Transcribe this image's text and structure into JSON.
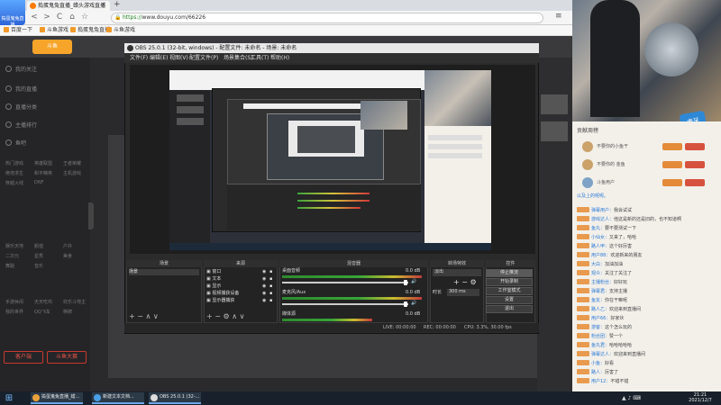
{
  "browser": {
    "tab_title": "捣蛋鬼兔直播_蜡头游戏直播",
    "tab_close": "×",
    "new_tab": "+",
    "url_scheme": "https://",
    "url_host": "www.douyu.com/",
    "url_path": "66226",
    "nav": {
      "back": "<",
      "forward": ">",
      "reload": "C",
      "home": "⌂",
      "favorite": "☆"
    },
    "bookmarks": [
      "百度一下",
      "斗鱼游戏",
      "捣蛋鬼兔直播",
      "斗鱼游戏"
    ]
  },
  "logo_text": "捣蛋鬼兔直播",
  "site": {
    "logo": "斗鱼",
    "sidebar_items": [
      "我的关注",
      "我的直播",
      "直播分类",
      "主播排行",
      "鱼吧"
    ],
    "sidebar_grid_1": [
      "热门游戏",
      "英雄联盟",
      "王者荣耀",
      "绝地求生",
      "和平精英",
      "主机游戏",
      "穿越火线",
      "DNF"
    ],
    "sidebar_grid_2": [
      "娱乐天地",
      "颜值",
      "户外",
      "二次元",
      "星秀",
      "美食",
      "舞蹈",
      "音乐"
    ],
    "sidebar_grid_3": [
      "手游休闲",
      "天天吃鸡",
      "欢乐斗地主",
      "我的世界",
      "QQ飞车",
      "棋牌"
    ],
    "side_btn_1": "客户端",
    "side_btn_2": "斗鱼大赛"
  },
  "cam": {
    "badge": "虎牙"
  },
  "chat": {
    "rank_title": "贡献周榜",
    "ranks": [
      "不要你的小鱼干",
      "不要你的 金鱼",
      "斗鱼用户"
    ],
    "welcome": "以及上的呢呢。",
    "messages": [
      {
        "user": "弹幕用户",
        "text": "我会试试"
      },
      {
        "user": "游戏达人",
        "text": "他这是新的还是旧的，也不知道啊"
      },
      {
        "user": "鱼丸",
        "text": "要不要测试一下"
      },
      {
        "user": "小仙女",
        "text": "又来了，哈哈"
      },
      {
        "user": "路人甲",
        "text": "这个好厉害"
      },
      {
        "user": "用户88",
        "text": "欢迎新来的朋友"
      },
      {
        "user": "大白",
        "text": "加油加油"
      },
      {
        "user": "观众",
        "text": "关注了关注了"
      },
      {
        "user": "主播粉丝",
        "text": "好好玩"
      },
      {
        "user": "弹幕君",
        "text": "支持主播"
      },
      {
        "user": "鱼友",
        "text": "你在干嘛呢"
      },
      {
        "user": "路人乙",
        "text": "欢迎来到直播间"
      },
      {
        "user": "用户66",
        "text": "好家伙"
      },
      {
        "user": "游客",
        "text": "这个怎么玩的"
      },
      {
        "user": "粉丝团",
        "text": "赞一个"
      },
      {
        "user": "鱼丸君",
        "text": "哈哈哈哈哈"
      },
      {
        "user": "弹幕达人",
        "text": "欢迎来到直播间"
      },
      {
        "user": "小鱼",
        "text": "好看"
      },
      {
        "user": "路人",
        "text": "厉害了"
      },
      {
        "user": "用户12",
        "text": "不错不错"
      }
    ]
  },
  "obs": {
    "title": "OBS 25.0.1 (32-bit, windows) - 配置文件: 未命名 - 场景: 未命名",
    "menu": [
      "文件(F)",
      "编辑(E)",
      "视图(V)",
      "配置文件(P)",
      "场景集合(S)",
      "工具(T)",
      "帮助(H)"
    ],
    "docks": {
      "scenes": "场景",
      "sources": "来源",
      "mixer": "混音器",
      "transitions": "转场特效",
      "controls": "控件"
    },
    "scene_item": "场景",
    "sources": [
      "窗口",
      "文本",
      "显示",
      "视频捕获设备",
      "显示器捕获"
    ],
    "mixer": {
      "ch1": "桌面音频",
      "ch1_db": "0.0 dB",
      "ch2": "麦克风/Aux",
      "ch2_db": "0.0 dB",
      "ch3": "媒体源",
      "ch3_db": "0.0 dB"
    },
    "transition": {
      "type": "淡出",
      "duration_label": "时长",
      "duration_value": "300 ms"
    },
    "controls": [
      "停止推流",
      "开始录制",
      "工作室模式",
      "设置",
      "退出"
    ],
    "status": {
      "live": "LIVE: 00:00:00",
      "rec": "REC: 00:00:00",
      "cpu": "CPU: 3.3%, 30.00 fps"
    },
    "foot": {
      "add": "+",
      "remove": "−",
      "up": "∧",
      "down": "∨",
      "gear": "⚙"
    }
  },
  "taskbar": {
    "start": "⊞",
    "tasks": [
      "捣蛋鬼兔直播_蜡...",
      "新建文本文档...",
      "OBS 25.0.1 (32-..."
    ],
    "tray": "▲ ♪ ⌨",
    "time": "21:21",
    "date": "2021/12/7"
  }
}
